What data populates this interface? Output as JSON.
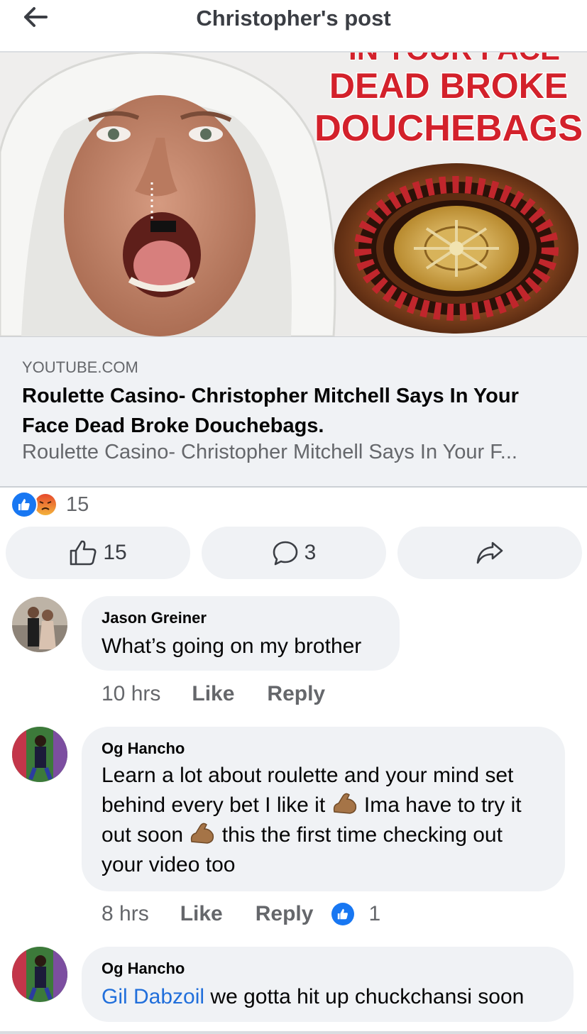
{
  "header": {
    "title": "Christopher's post",
    "back_icon": "arrow-left-icon"
  },
  "thumbnail": {
    "text_line0": "IN YOUR FACE",
    "text_line1": "DEAD BROKE",
    "text_line2": "DOUCHEBAGS",
    "text_color": "#d3212b"
  },
  "link": {
    "domain": "YOUTUBE.COM",
    "title": "Roulette Casino- Christopher Mitchell Says In Your Face Dead Broke Douchebags.",
    "description": "Roulette Casino- Christopher Mitchell Says In Your F..."
  },
  "reactions": {
    "count": "15",
    "types": [
      "like",
      "angry"
    ]
  },
  "actions": {
    "like_count": "15",
    "comment_count": "3",
    "like_icon": "thumbs-up-outline-icon",
    "comment_icon": "comment-bubble-icon",
    "share_icon": "share-arrow-icon"
  },
  "comments": [
    {
      "author": "Jason Greiner",
      "text": "What’s going on my brother",
      "time": "10 hrs",
      "like_label": "Like",
      "reply_label": "Reply"
    },
    {
      "author": "Og Hancho",
      "text_l1": "Learn a lot about roulette and your mind set",
      "text_l2a": "behind every bet I like it",
      "text_l2b": "Ima have to try it",
      "text_l3a": "out soon",
      "text_l3b": "this the first time checking out",
      "text_l4": "your video too",
      "time": "8 hrs",
      "like_label": "Like",
      "reply_label": "Reply",
      "likes": "1"
    },
    {
      "author": "Og Hancho",
      "mention": "Gil Dabzoil",
      "text": " we gotta hit up chuckchansi soon"
    }
  ],
  "colors": {
    "accent": "#1877f2",
    "bubble": "#f0f2f5",
    "secondary_text": "#65676b",
    "mention": "#216fdb"
  }
}
